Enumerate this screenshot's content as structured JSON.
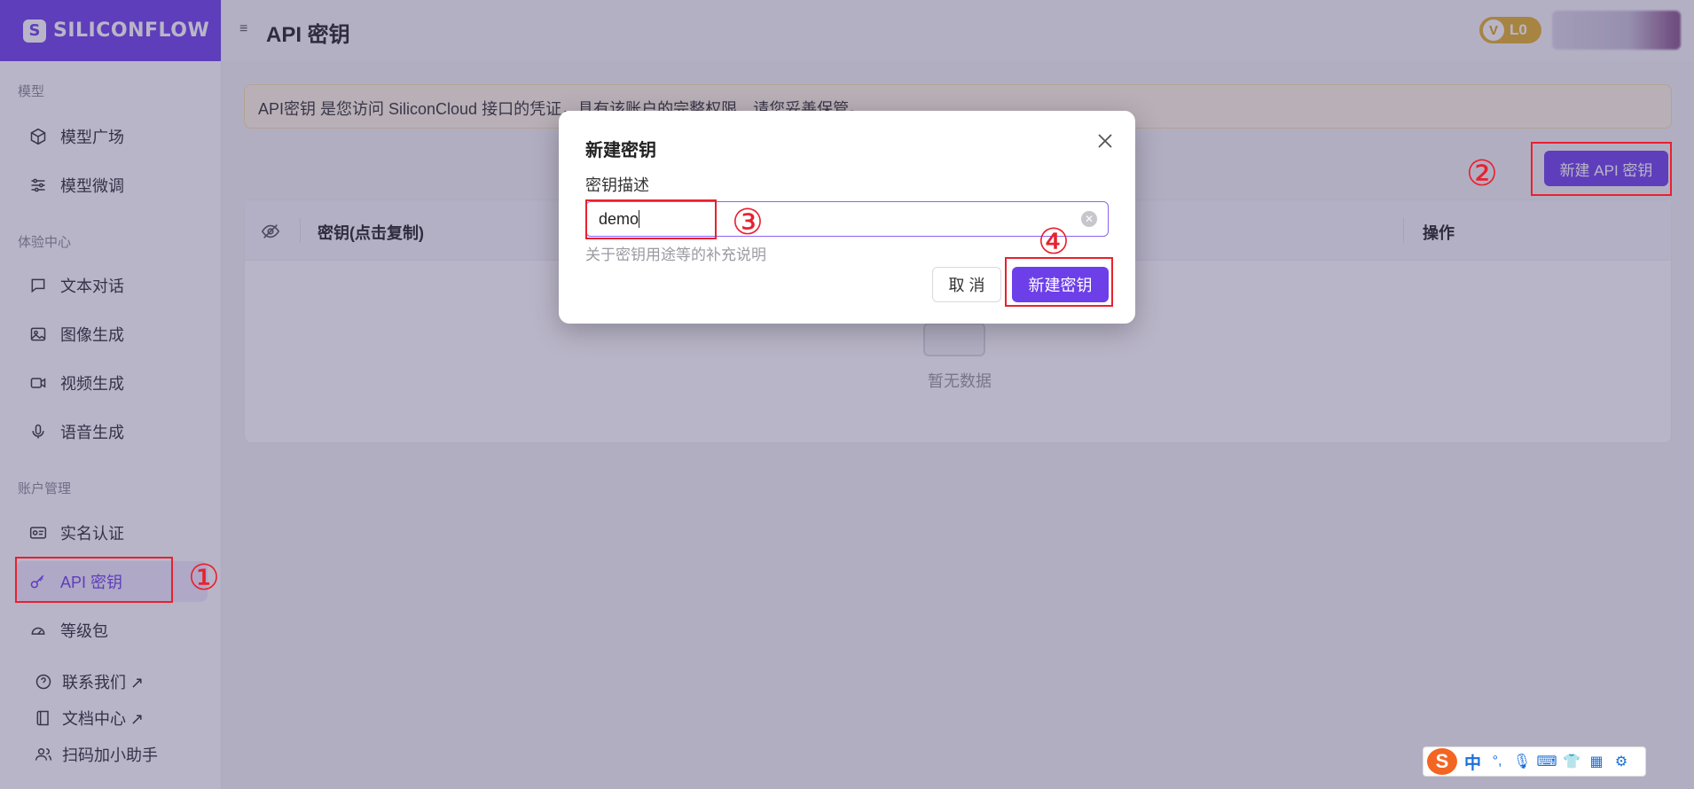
{
  "app": {
    "logo_text": "SILICONFLOW",
    "logo_mark": "S",
    "brand_color": "#6d3fe8"
  },
  "header": {
    "menu_icon": "≡",
    "title": "API 密钥",
    "level_badge": "L0",
    "level_badge_letter": "V"
  },
  "sidebar": {
    "sections": [
      {
        "label": "模型"
      },
      {
        "label": "体验中心"
      },
      {
        "label": "账户管理"
      }
    ],
    "items": [
      {
        "label": "模型广场",
        "icon": "cube-icon"
      },
      {
        "label": "模型微调",
        "icon": "sliders-icon"
      },
      {
        "label": "文本对话",
        "icon": "chat-icon"
      },
      {
        "label": "图像生成",
        "icon": "image-icon"
      },
      {
        "label": "视频生成",
        "icon": "video-icon"
      },
      {
        "label": "语音生成",
        "icon": "mic-icon"
      },
      {
        "label": "实名认证",
        "icon": "id-card-icon"
      },
      {
        "label": "API 密钥",
        "icon": "key-icon",
        "active": true
      },
      {
        "label": "等级包",
        "icon": "gauge-icon"
      },
      {
        "label": "联系我们 ↗",
        "icon": "help-icon"
      },
      {
        "label": "文档中心 ↗",
        "icon": "book-icon"
      },
      {
        "label": "扫码加小助手",
        "icon": "users-icon"
      }
    ]
  },
  "main": {
    "notice": "API密钥 是您访问 SiliconCloud 接口的凭证，具有该账户的完整权限，请您妥善保管。",
    "new_key_button": "新建 API 密钥",
    "table": {
      "columns": [
        "密钥(点击复制)",
        "操作"
      ],
      "empty_text": "暂无数据"
    }
  },
  "modal": {
    "title": "新建密钥",
    "field_label": "密钥描述",
    "input_value": "demo",
    "help_text": "关于密钥用途等的补充说明",
    "cancel_label": "取 消",
    "submit_label": "新建密钥"
  },
  "annotations": {
    "marks": [
      "①",
      "②",
      "③",
      "④"
    ],
    "color": "#e8212e"
  },
  "ime": {
    "logo": "S",
    "lang": "中",
    "icons": [
      "punctuation-icon",
      "mic-icon",
      "keyboard-icon",
      "skin-icon",
      "grid-icon",
      "settings-icon"
    ],
    "glyphs": [
      "°,",
      "🎙",
      "⌨",
      "👕",
      "▦",
      "⚙"
    ]
  }
}
